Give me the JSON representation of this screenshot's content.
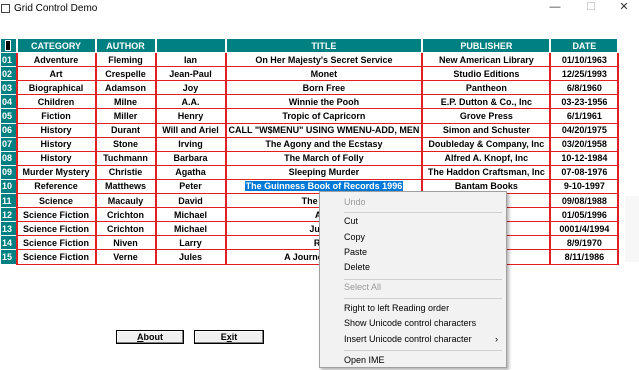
{
  "window": {
    "title": "Grid Control Demo",
    "min_glyph": "—",
    "max_glyph": "☐",
    "close_glyph": "✕"
  },
  "grid": {
    "columns": [
      "CATEGORY",
      "AUTHOR",
      "",
      "TITLE",
      "PUBLISHER",
      "DATE"
    ],
    "rows": [
      {
        "num": "01",
        "cells": [
          "Adventure",
          "Fleming",
          "Ian",
          "On Her Majesty's Secret Service",
          "New American Library",
          "01/10/1963"
        ]
      },
      {
        "num": "02",
        "cells": [
          "Art",
          "Crespelle",
          "Jean-Paul",
          "Monet",
          "Studio Editions",
          "12/25/1993"
        ]
      },
      {
        "num": "03",
        "cells": [
          "Biographical",
          "Adamson",
          "Joy",
          "Born Free",
          "Pantheon",
          "6/8/1960"
        ]
      },
      {
        "num": "04",
        "cells": [
          "Children",
          "Milne",
          "A.A.",
          "Winnie the Pooh",
          "E.P. Dutton & Co., Inc",
          "03-23-1956"
        ]
      },
      {
        "num": "05",
        "cells": [
          "Fiction",
          "Miller",
          "Henry",
          "Tropic of Capricorn",
          "Grove Press",
          "6/1/1961"
        ]
      },
      {
        "num": "06",
        "cells": [
          "History",
          "Durant",
          "Will and Ariel",
          "CALL \"W$MENU\" USING WMENU-ADD, MEN",
          "Simon and Schuster",
          "04/20/1975"
        ]
      },
      {
        "num": "07",
        "cells": [
          "History",
          "Stone",
          "Irving",
          "The Agony and the Ecstasy",
          "Doubleday & Company, Inc",
          "03/20/1958"
        ]
      },
      {
        "num": "08",
        "cells": [
          "History",
          "Tuchmann",
          "Barbara",
          "The March of Folly",
          "Alfred A. Knopf, Inc",
          "10-12-1984"
        ]
      },
      {
        "num": "09",
        "cells": [
          "Murder Mystery",
          "Christie",
          "Agatha",
          "Sleeping Murder",
          "The Haddon Craftsman, Inc",
          "07-08-1976"
        ]
      },
      {
        "num": "10",
        "cells": [
          "Reference",
          "Matthews",
          "Peter",
          "The Guinness Book of Records 1996",
          "Bantam Books",
          "9-10-1997"
        ]
      },
      {
        "num": "11",
        "cells": [
          "Science",
          "Macauly",
          "David",
          "The Way T",
          "",
          "09/08/1988"
        ]
      },
      {
        "num": "12",
        "cells": [
          "Science Fiction",
          "Crichton",
          "Michael",
          "AirF",
          "Inc",
          "01/05/1996"
        ]
      },
      {
        "num": "13",
        "cells": [
          "Science Fiction",
          "Crichton",
          "Michael",
          "Jurass",
          "",
          "0001/4/1994"
        ]
      },
      {
        "num": "14",
        "cells": [
          "Science Fiction",
          "Niven",
          "Larry",
          "Ring",
          "ks",
          "8/9/1970"
        ]
      },
      {
        "num": "15",
        "cells": [
          "Science Fiction",
          "Verne",
          "Jules",
          "A Journey to the C",
          "c",
          "8/11/1986"
        ]
      }
    ],
    "selected_text": "The Guinness Book of Records 1996"
  },
  "buttons": {
    "about": {
      "pre": "",
      "accel": "A",
      "post": "bout"
    },
    "exit": {
      "pre": "E",
      "accel": "x",
      "post": "it"
    }
  },
  "context_menu": {
    "items": [
      {
        "label": "Undo",
        "disabled": true
      },
      {
        "label": "Cut",
        "disabled": false
      },
      {
        "label": "Copy",
        "disabled": false
      },
      {
        "label": "Paste",
        "disabled": false
      },
      {
        "label": "Delete",
        "disabled": false
      },
      {
        "label": "Select All",
        "disabled": true
      },
      {
        "label": "Right to left Reading order",
        "disabled": false
      },
      {
        "label": "Show Unicode control characters",
        "disabled": false
      },
      {
        "label": "Insert Unicode control character",
        "disabled": false,
        "submenu": true
      },
      {
        "label": "Open IME",
        "disabled": false
      }
    ],
    "submenu_arrow": "›"
  }
}
